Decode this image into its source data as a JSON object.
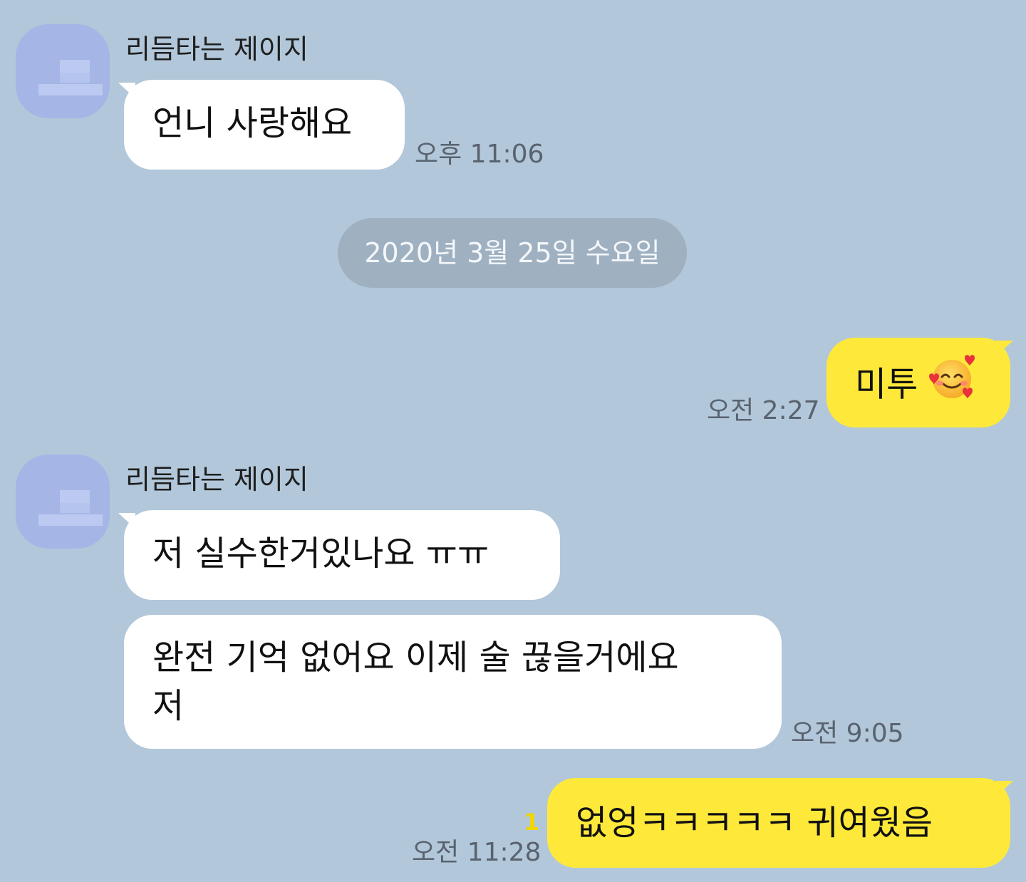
{
  "messages": [
    {
      "sender": "리듬타는 제이지",
      "text": "언니 사랑해요",
      "time": "오후 11:06"
    },
    {
      "date_divider": "2020년 3월 25일 수요일"
    },
    {
      "text": "미투",
      "emoji": "smiling-face-with-hearts",
      "time": "오전 2:27"
    },
    {
      "sender": "리듬타는 제이지",
      "text": "저 실수한거있나요 ㅠㅠ"
    },
    {
      "text": "완전 기억 없어요 이제 술 끊을거에요\n저",
      "time": "오전 9:05"
    },
    {
      "text": "없엉ㅋㅋㅋㅋㅋ 귀여웠음",
      "unread": "1",
      "time": "오전 11:28"
    }
  ],
  "colors": {
    "background": "#b2c7da",
    "incoming_bubble": "#ffffff",
    "outgoing_bubble": "#fee93a",
    "date_pill": "#9fb0c1",
    "unread_count": "#f2d600",
    "avatar": "#a5b6e6"
  }
}
